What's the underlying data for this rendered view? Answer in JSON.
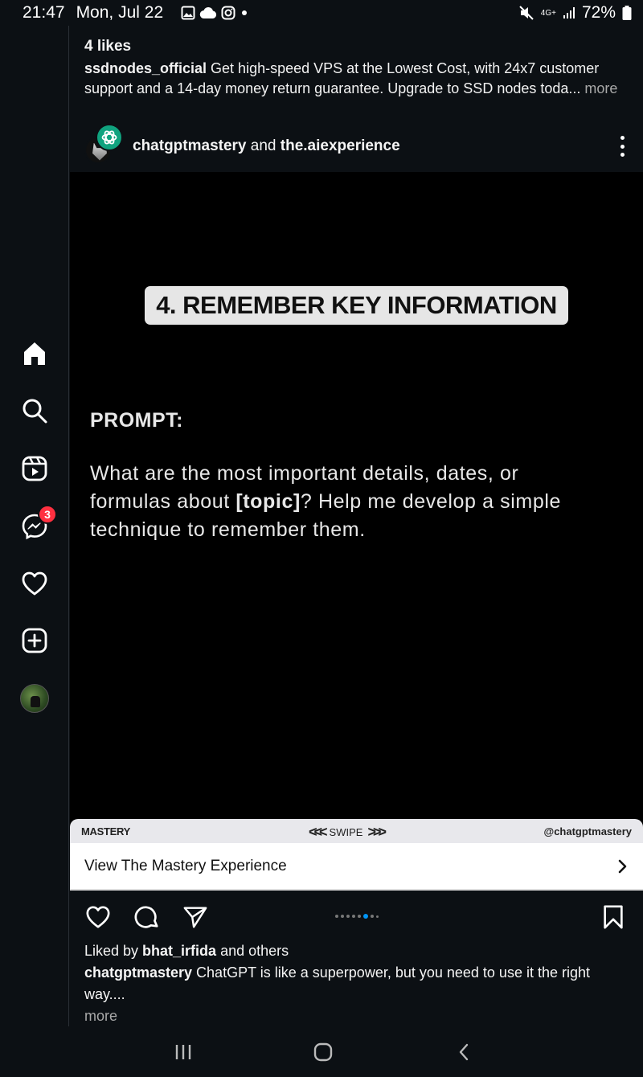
{
  "status_bar": {
    "time": "21:47",
    "date": "Mon, Jul 22",
    "network": "4G+",
    "battery": "72%"
  },
  "sidebar": {
    "items": [
      {
        "icon": "home-icon"
      },
      {
        "icon": "search-icon"
      },
      {
        "icon": "reels-icon"
      },
      {
        "icon": "messenger-icon",
        "badge": "3"
      },
      {
        "icon": "heart-icon"
      },
      {
        "icon": "create-icon"
      },
      {
        "icon": "profile-avatar"
      }
    ]
  },
  "previous_post": {
    "likes": "4 likes",
    "author": "ssdnodes_official",
    "caption": " Get high-speed VPS at the Lowest Cost, with 24x7 customer support and a 14-day money return guarantee. Upgrade to SSD nodes toda...",
    "more": " more"
  },
  "post": {
    "author1": "chatgptmastery",
    "joiner": " and ",
    "author2": "the.aiexperience",
    "image": {
      "heading": "4. REMEMBER KEY INFORMATION",
      "prompt_label": "PROMPT:",
      "prompt_text_before": "What are the most important details, dates, or formulas about ",
      "prompt_topic": "[topic]",
      "prompt_text_after": "? Help me develop a simple technique to remember them.",
      "strip_brand": "MASTERY",
      "strip_swipe": "SWIPE",
      "strip_handle": "@chatgptmastery"
    },
    "cta_label": "View The Mastery Experience",
    "carousel": {
      "count": 8,
      "active_index": 4
    },
    "liked_prefix": "Liked by ",
    "liked_user": "bhat_irfida",
    "liked_suffix": " and others",
    "caption_author": "chatgptmastery",
    "caption_text": " ChatGPT is like a superpower, but you need to use it the right way....",
    "caption_more": "more"
  },
  "colors": {
    "background": "#0c1014",
    "badge": "#ff3040",
    "accent": "#0095f6",
    "openai_green": "#10a37f"
  }
}
